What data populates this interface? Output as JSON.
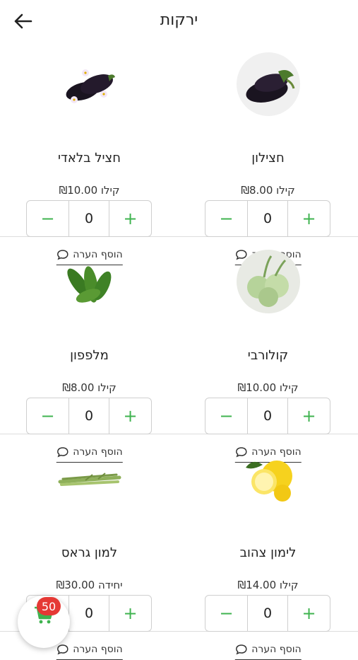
{
  "header": {
    "title": "ירקות",
    "back_icon": "arrow-left-icon"
  },
  "products": [
    {
      "name": "חצילון",
      "price": "קילו ₪8.00",
      "qty": "0",
      "note_label": "הוסף הערה",
      "image": "baby-eggplant"
    },
    {
      "name": "חציל בלאדי",
      "price": "קילו ₪10.00",
      "qty": "0",
      "note_label": "הוסף הערה",
      "image": "eggplants"
    },
    {
      "name": "קולורבי",
      "price": "קילו ₪10.00",
      "qty": "0",
      "note_label": "הוסף הערה",
      "image": "kohlrabi"
    },
    {
      "name": "מלפפון",
      "price": "קילו ₪8.00",
      "qty": "0",
      "note_label": "הוסף הערה",
      "image": "cucumbers"
    },
    {
      "name": "לימון צהוב",
      "price": "קילו ₪14.00",
      "qty": "0",
      "note_label": "הוסף הערה",
      "image": "lemons"
    },
    {
      "name": "למון גראס",
      "price": "יחידה ₪30.00",
      "qty": "0",
      "note_label": "הוסף הערה",
      "image": "lemongrass"
    }
  ],
  "stepper": {
    "minus": "−",
    "plus": "+"
  },
  "cart": {
    "count": "50",
    "icon": "cart-icon"
  },
  "colors": {
    "accent": "#3fb34f",
    "badge": "#e53935",
    "divider": "#dddddd"
  }
}
